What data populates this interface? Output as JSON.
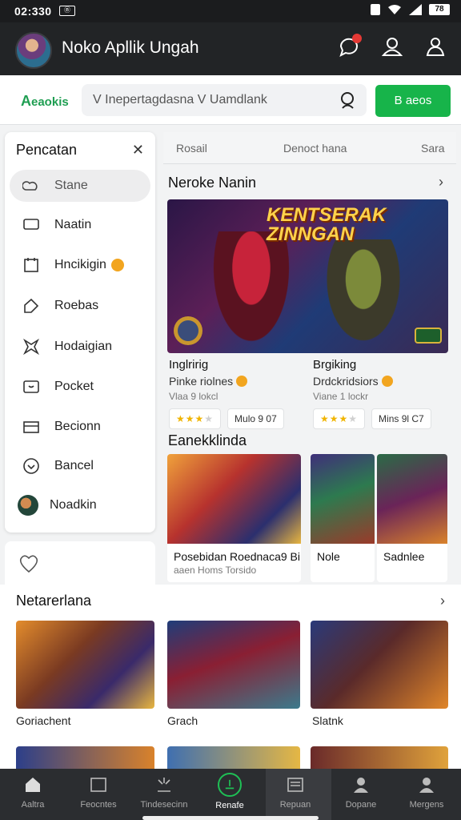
{
  "status_bar": {
    "time": "02:330",
    "left_icon_text": "Ⓑ",
    "battery": "78"
  },
  "app_bar": {
    "title": "Noko Apllik Ungah"
  },
  "search_row": {
    "brand": "A",
    "brand_rest": "eaokis",
    "query": "V  Inepertagdasna  V  Uamdlank",
    "go_label": "B aeos"
  },
  "sidebar": {
    "title": "Pencatan",
    "items": [
      {
        "label": "Stane",
        "icon": "cloud-icon"
      },
      {
        "label": "Naatin",
        "icon": "chat-icon"
      },
      {
        "label": "Hncikigin",
        "icon": "calendar-icon"
      },
      {
        "label": "Roebas",
        "icon": "tag-icon"
      },
      {
        "label": "Hodaigian",
        "icon": "star-icon"
      },
      {
        "label": "Pocket",
        "icon": "pocket-icon"
      },
      {
        "label": "Becionn",
        "icon": "card-icon"
      },
      {
        "label": "Bancel",
        "icon": "download-icon"
      },
      {
        "label": "Noadkin",
        "icon": "user-avatar"
      }
    ]
  },
  "tabs": [
    "Rosail",
    "Denoct hana",
    "Sara"
  ],
  "featured": {
    "heading": "Neroke Nanin",
    "hero_title": "KENTSERAK ZINNGAN",
    "cards": [
      {
        "name": "Inglririg",
        "sub": "Pinke riolnes",
        "sub2": "Vlaa 9 lokcl",
        "rating": 3,
        "pill": "Mulo  9  07"
      },
      {
        "name": "Brgiking",
        "sub": "Drdckridsiors",
        "sub2": "Viane 1 lockr",
        "rating": 3,
        "pill": "Mins  9l  C7"
      }
    ]
  },
  "second_section": {
    "heading": "Eanekklinda",
    "thumbs": [
      {
        "label": "Posebidan Roednaca9  Bi",
        "label2": "aaen  Homs  Torsido"
      },
      {
        "label": "Nole",
        "label2": ""
      },
      {
        "label": "Sadnlee",
        "label2": ""
      }
    ]
  },
  "bottom_section": {
    "heading": "Netarerlana",
    "captions": [
      "Goriachent",
      "Grach",
      "Slatnk"
    ]
  },
  "nav": [
    {
      "label": "Aaltra",
      "icon": "home-icon"
    },
    {
      "label": "Feocntes",
      "icon": "image-icon"
    },
    {
      "label": "Tindesecinn",
      "icon": "burst-icon"
    },
    {
      "label": "Renafe",
      "icon": "power-icon"
    },
    {
      "label": "Repuan",
      "icon": "newspaper-icon"
    },
    {
      "label": "Dopane",
      "icon": "person-icon"
    },
    {
      "label": "Mergens",
      "icon": "person-icon"
    }
  ],
  "colors": {
    "accent": "#17b44a",
    "appbar": "#222426",
    "navbar": "#2b2d30",
    "coin": "#f2a51f"
  }
}
